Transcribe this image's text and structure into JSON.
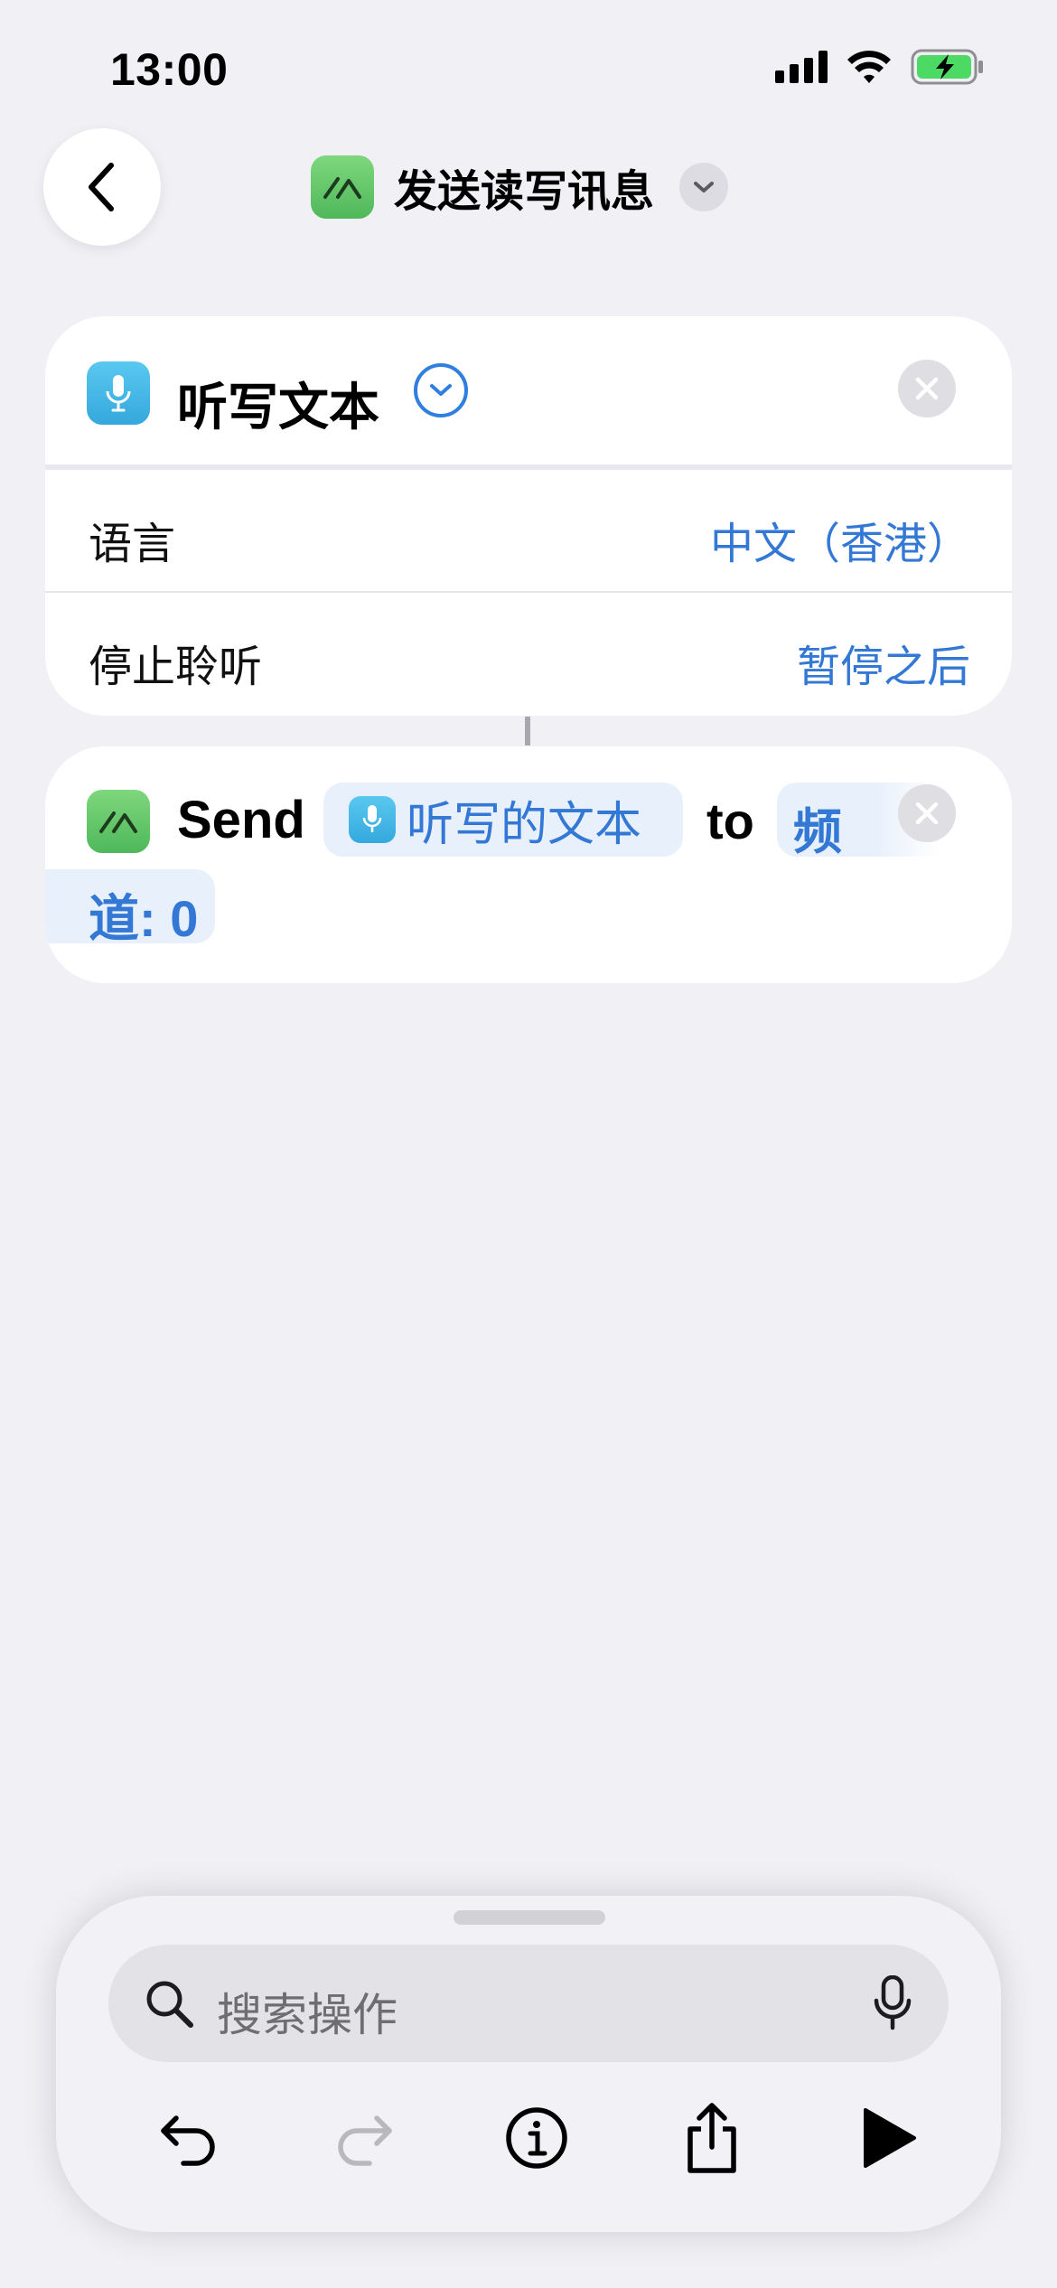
{
  "status_bar": {
    "time": "13:00"
  },
  "header": {
    "back_icon": "chevron-left-icon",
    "title": "发送读写讯息",
    "title_icon": "app-icon",
    "menu_icon": "chevron-down-icon"
  },
  "action_dictate": {
    "title": "听写文本",
    "rows": [
      {
        "label": "语言",
        "value": "中文（香港）"
      },
      {
        "label": "停止聆听",
        "value": "暂停之后"
      }
    ]
  },
  "action_send": {
    "verb": "Send",
    "input_token": "听写的文本",
    "preposition": "to",
    "channel_part1": "频",
    "channel_part2": "道: 0"
  },
  "bottom_sheet": {
    "search_placeholder": "搜索操作",
    "toolbar": [
      "undo-icon",
      "redo-icon",
      "info-icon",
      "share-icon",
      "play-icon"
    ]
  },
  "colors": {
    "accent": "#3478d6",
    "app_green": "#5cc46a",
    "dictate_blue": "#34a8dd"
  }
}
